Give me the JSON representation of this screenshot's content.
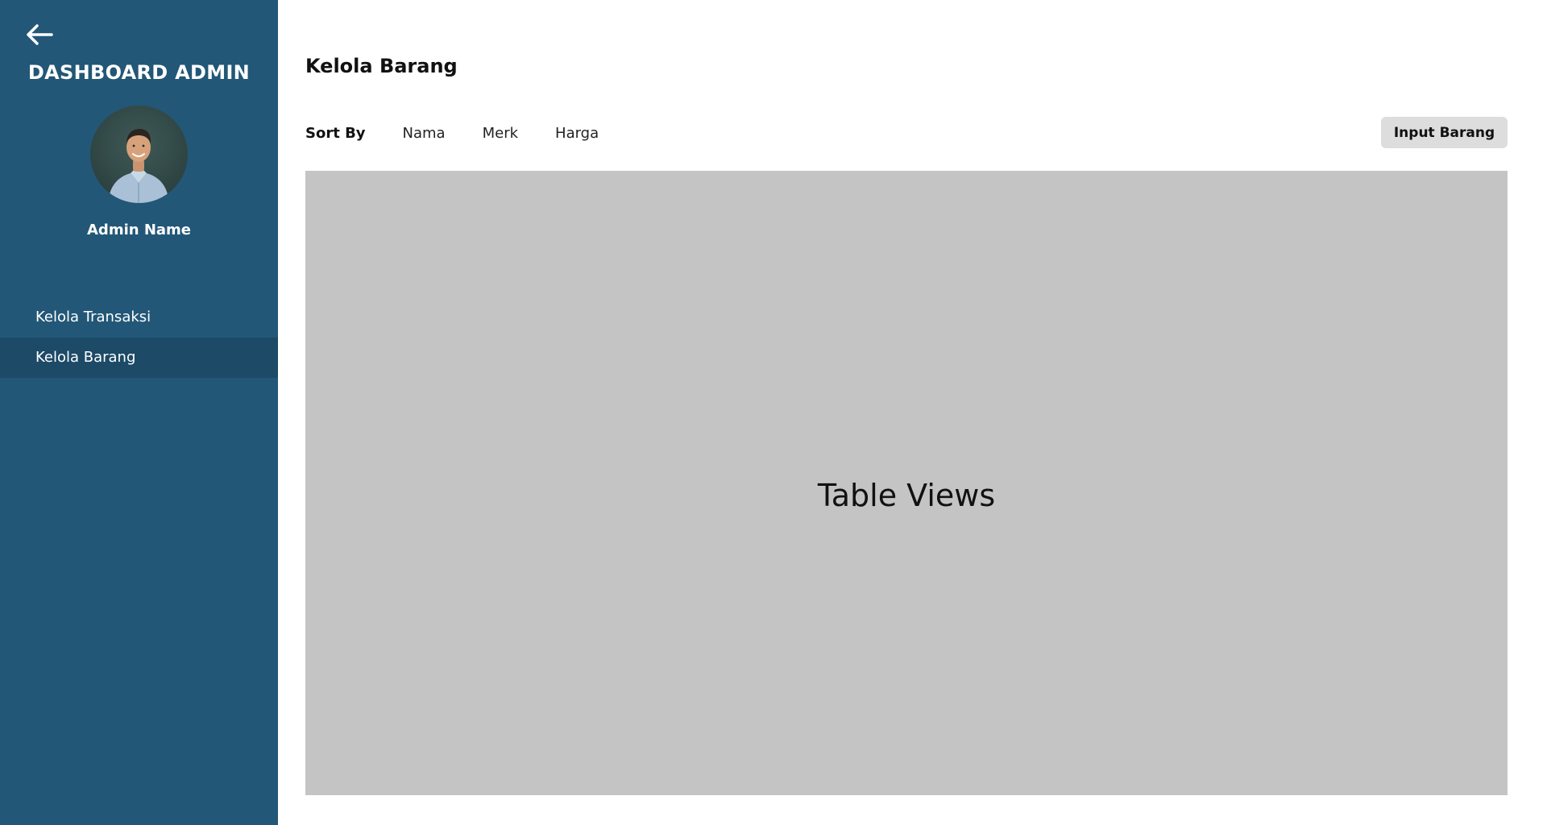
{
  "sidebar": {
    "back_icon": "arrow-left-icon",
    "title": "DASHBOARD ADMIN",
    "admin_name": "Admin Name",
    "nav_items": [
      {
        "label": "Kelola Transaksi",
        "active": false
      },
      {
        "label": "Kelola Barang",
        "active": true
      }
    ]
  },
  "main": {
    "title": "Kelola Barang",
    "sort": {
      "label": "Sort By",
      "options": [
        "Nama",
        "Merk",
        "Harga"
      ]
    },
    "input_button_label": "Input Barang",
    "table_placeholder": "Table Views"
  },
  "colors": {
    "sidebar_bg": "#225777",
    "sidebar_active_bg": "#1c4a67",
    "table_bg": "#c4c4c4",
    "button_bg": "#dddddd"
  }
}
